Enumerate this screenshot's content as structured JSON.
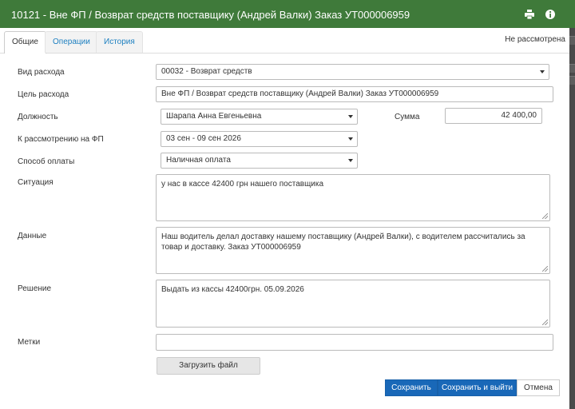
{
  "window": {
    "title": "10121 - Вне ФП / Возврат средств поставщику (Андрей Валки) Заказ УТ000006959"
  },
  "tabs": [
    {
      "label": "Общие",
      "active": true
    },
    {
      "label": "Операции",
      "active": false
    },
    {
      "label": "История",
      "active": false
    }
  ],
  "status": "Не рассмотрена",
  "form": {
    "expense_type": {
      "label": "Вид расхода",
      "value": "00032 - Возврат средств"
    },
    "expense_purpose": {
      "label": "Цель расхода",
      "value": "Вне ФП / Возврат средств поставщику (Андрей Валки) Заказ УТ000006959"
    },
    "position": {
      "label": "Должность",
      "value": "Шарапа Анна Евгеньевна"
    },
    "amount": {
      "label": "Сумма",
      "value": "42 400,00"
    },
    "fp_review": {
      "label": "К рассмотрению на ФП",
      "value": "03 сен - 09 сен 2026"
    },
    "payment_method": {
      "label": "Способ оплаты",
      "value": "Наличная оплата"
    },
    "situation": {
      "label": "Ситуация",
      "value": "у нас в кассе 42400 грн нашего поставщика"
    },
    "details": {
      "label": "Данные",
      "value": "Наш водитель делал доставку нашему поставщику (Андрей Валки), с водителем рассчитались за товар и доставку. Заказ УТ000006959"
    },
    "decision": {
      "label": "Решение",
      "value": "Выдать из кассы 42400грн. 05.09.2026"
    },
    "tags": {
      "label": "Метки",
      "value": ""
    }
  },
  "buttons": {
    "upload": "Загрузить файл",
    "save": "Сохранить",
    "save_exit": "Сохранить и выйти",
    "cancel": "Отмена"
  },
  "colors": {
    "titlebar": "#3f7a3a",
    "primary_button": "#1968b8",
    "tab_link": "#1c7fc0"
  },
  "icons": {
    "print": "printer-icon",
    "info": "info-icon"
  }
}
